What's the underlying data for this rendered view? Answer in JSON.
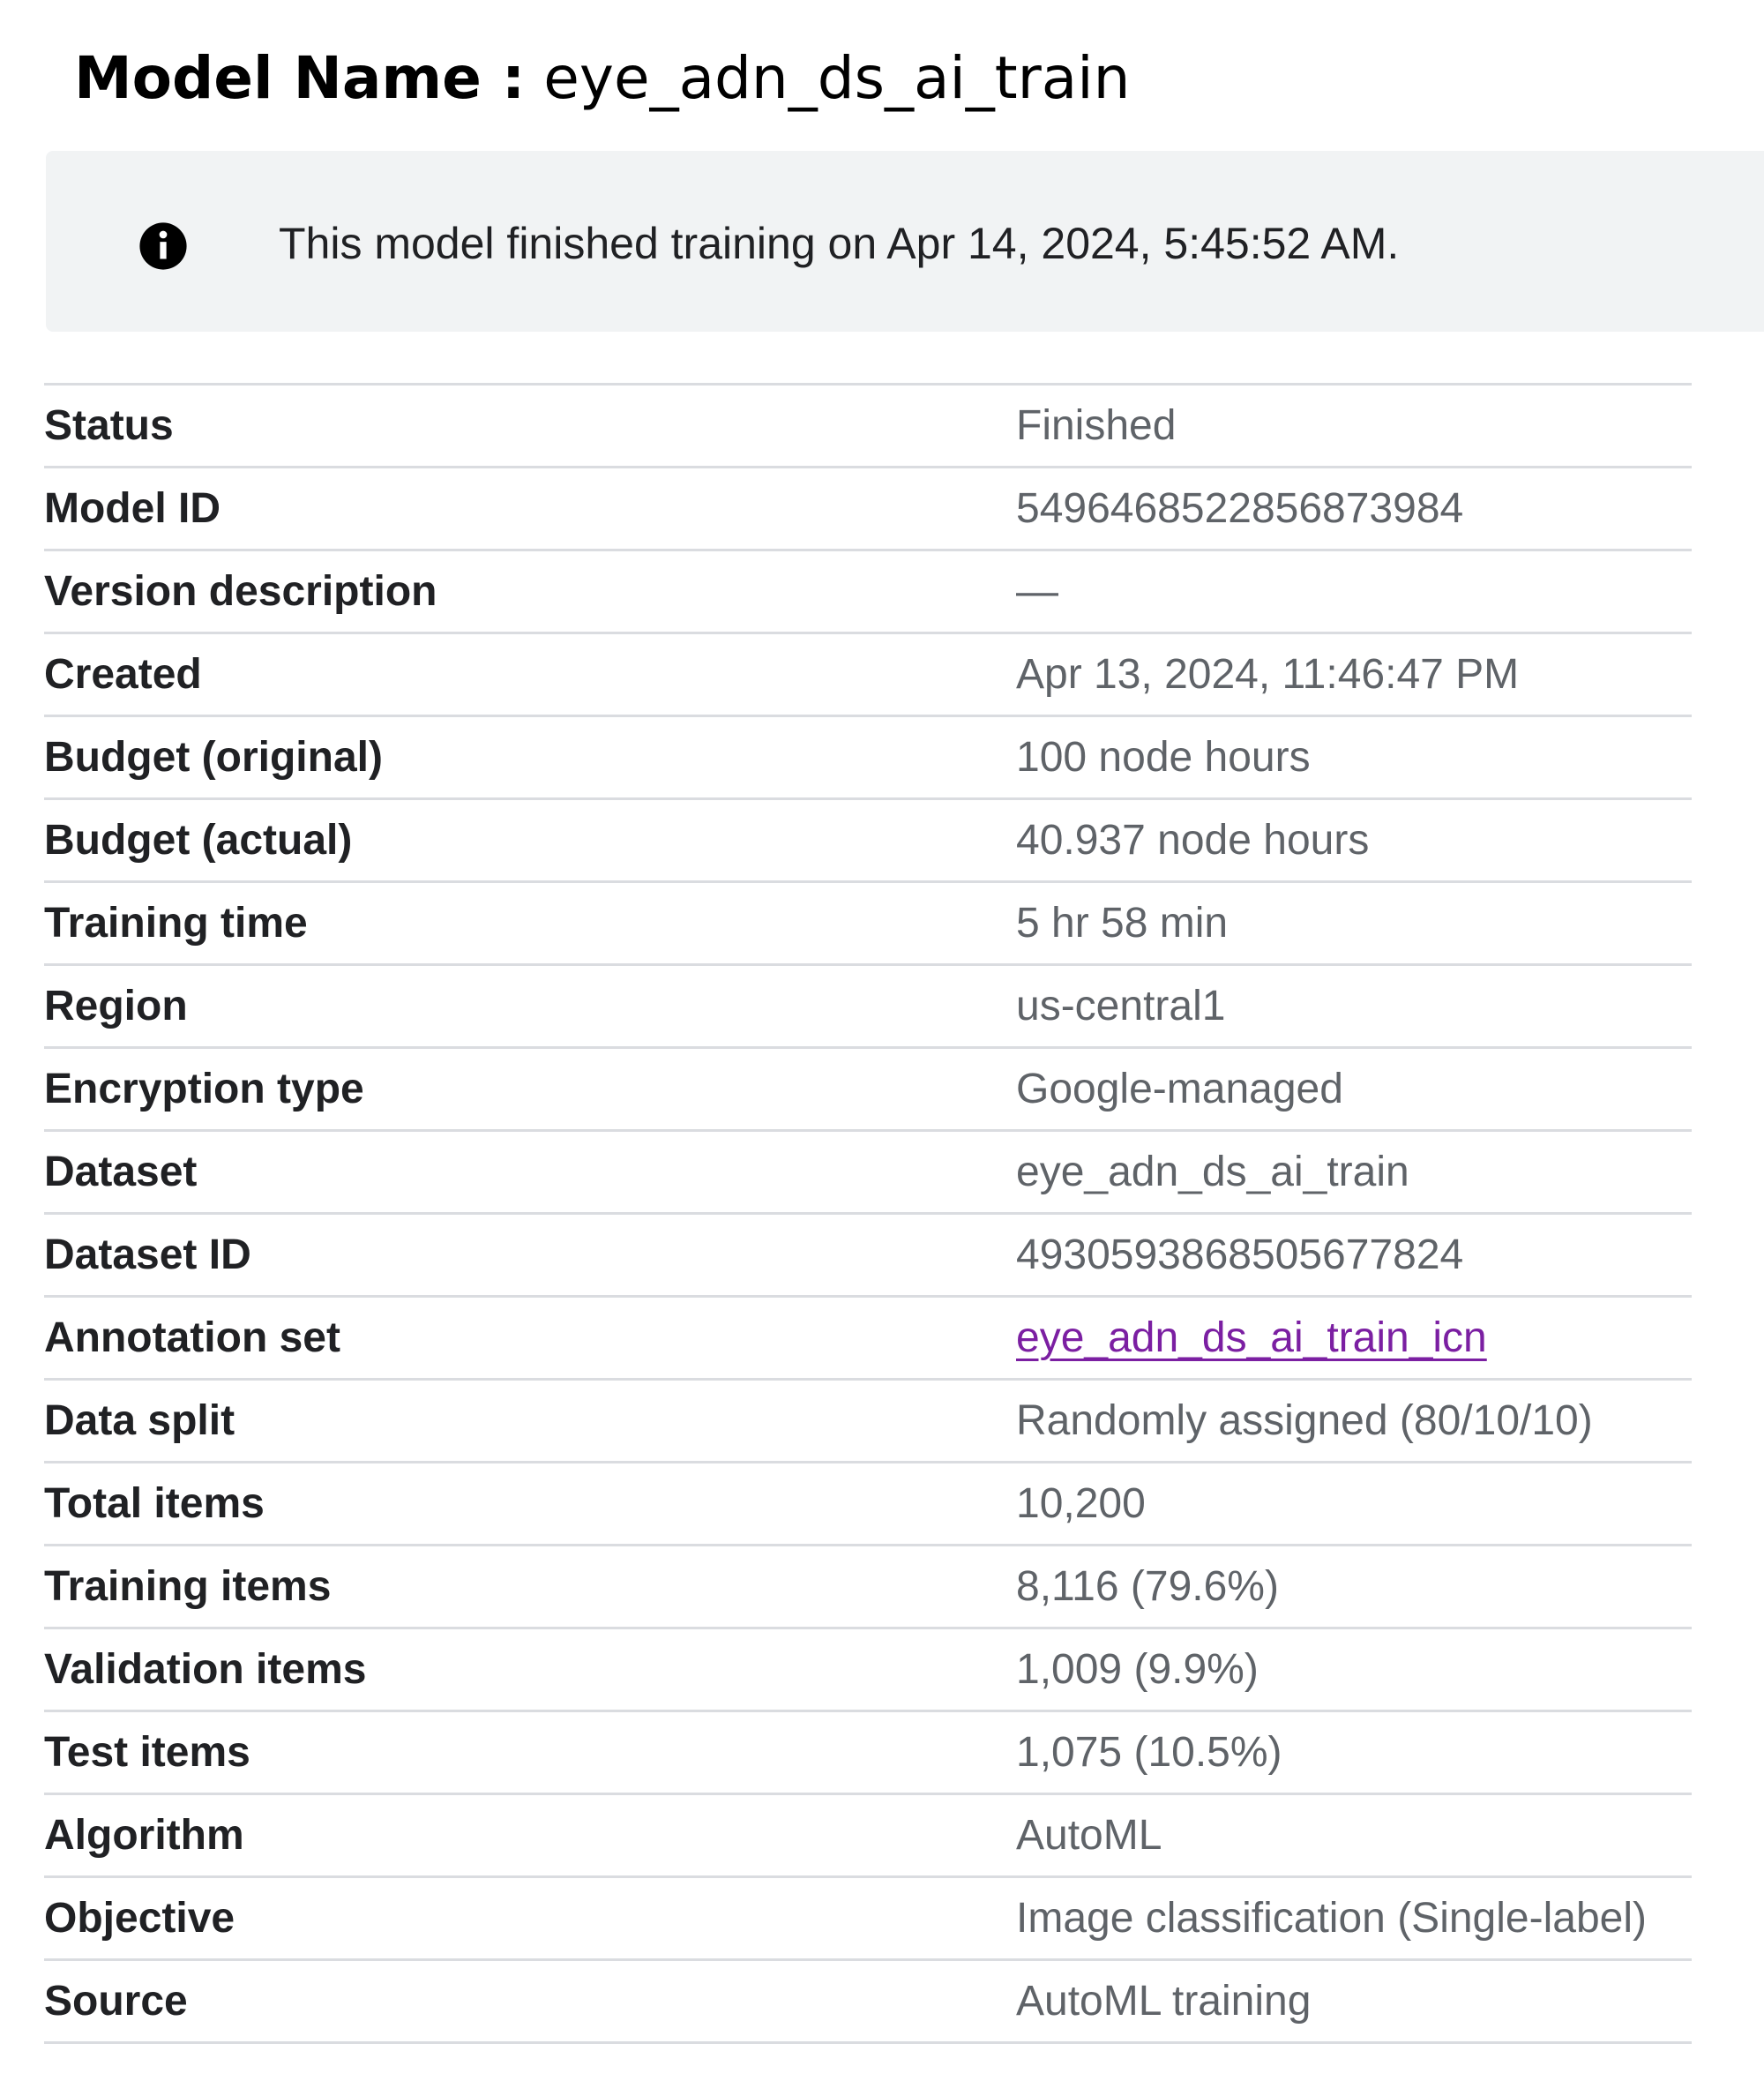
{
  "header": {
    "label": "Model Name :",
    "value": "eye_adn_ds_ai_train"
  },
  "banner": {
    "icon": "info-icon",
    "text": "This model finished training on Apr 14, 2024, 5:45:52 AM."
  },
  "details": [
    {
      "label": "Status",
      "value": "Finished"
    },
    {
      "label": "Model ID",
      "value": "5496468522856873984"
    },
    {
      "label": "Version description",
      "value": "—"
    },
    {
      "label": "Created",
      "value": "Apr 13, 2024, 11:46:47 PM"
    },
    {
      "label": "Budget (original)",
      "value": "100 node hours"
    },
    {
      "label": "Budget (actual)",
      "value": "40.937 node hours"
    },
    {
      "label": "Training time",
      "value": "5 hr 58 min"
    },
    {
      "label": "Region",
      "value": "us-central1"
    },
    {
      "label": "Encryption type",
      "value": "Google-managed"
    },
    {
      "label": "Dataset",
      "value": "eye_adn_ds_ai_train"
    },
    {
      "label": "Dataset ID",
      "value": "4930593868505677824"
    },
    {
      "label": "Annotation set",
      "value": "eye_adn_ds_ai_train_icn"
    },
    {
      "label": "Data split",
      "value": "Randomly assigned (80/10/10)"
    },
    {
      "label": "Total items",
      "value": "10,200"
    },
    {
      "label": "Training items",
      "value": "8,116 (79.6%)"
    },
    {
      "label": "Validation items",
      "value": "1,009 (9.9%)"
    },
    {
      "label": "Test items",
      "value": "1,075 (10.5%)"
    },
    {
      "label": "Algorithm",
      "value": "AutoML"
    },
    {
      "label": "Objective",
      "value": "Image classification (Single-label)"
    },
    {
      "label": "Source",
      "value": "AutoML training"
    }
  ],
  "colors": {
    "banner_bg": "#f1f3f4",
    "label_text": "#202124",
    "value_text": "#5f6368",
    "link": "#7b1fa2",
    "divider": "#dadce0"
  }
}
